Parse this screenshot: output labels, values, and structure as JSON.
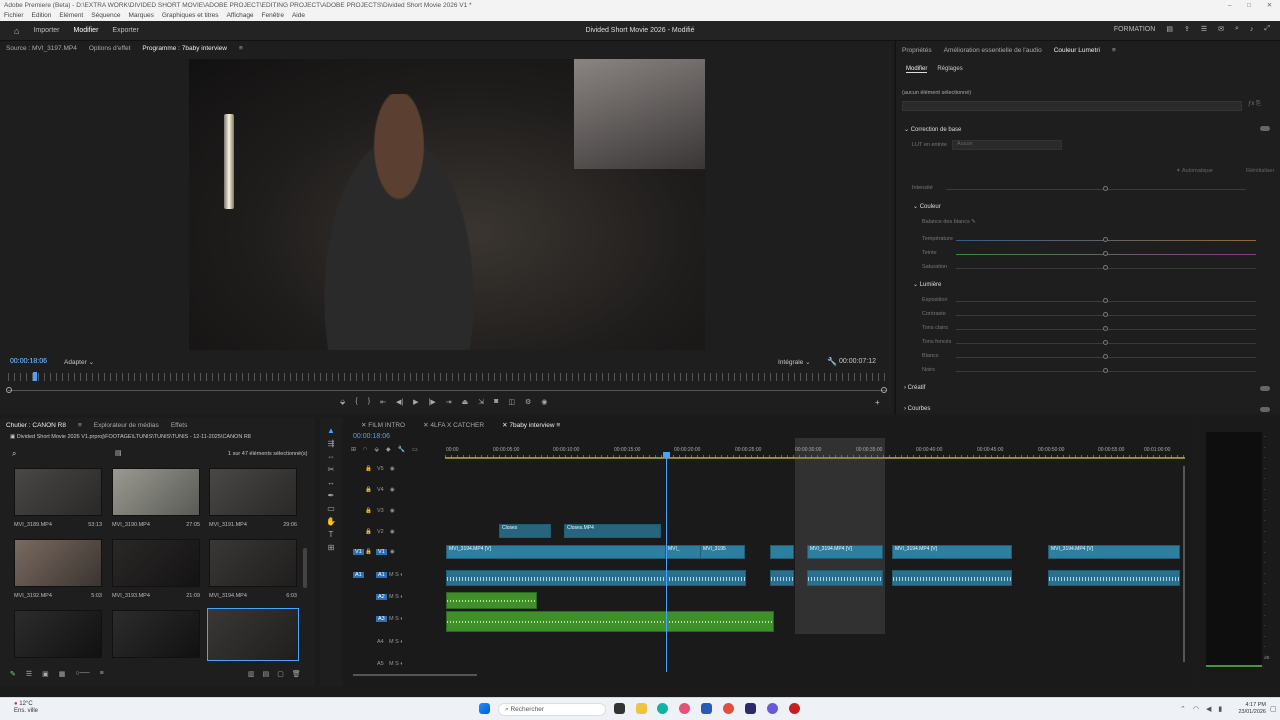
{
  "window": {
    "title": "Adobe Premiere (Beta) - D:\\EXTRA WORK\\DIVIDED SHORT MOVIE\\ADOBE PROJECT\\EDITING PROJECT\\ADOBE PROJECTS\\Divided Short Movie 2026 V1 *"
  },
  "menu": [
    "Fichier",
    "Edition",
    "Elément",
    "Séquence",
    "Marques",
    "Graphiques et titres",
    "Affichage",
    "Fenêtre",
    "Aide"
  ],
  "appbar": {
    "home_icon": "home-icon",
    "nav": [
      "Importer",
      "Modifier",
      "Exporter"
    ],
    "active_nav": "Modifier",
    "project_title": "Divided Short Movie 2026 - Modifié",
    "workspace": "FORMATION"
  },
  "source_panel": {
    "tabs": [
      "Source : MVI_3197.MP4",
      "Options d'effet",
      "Programme : 7baby interview"
    ],
    "timecode_left": "00:00:18:06",
    "fit": "Adapter",
    "quality": "Intégrale",
    "timecode_right": "00:00:07:12"
  },
  "lumetri": {
    "tabs": [
      "Propriétés",
      "Amélioration essentielle de l'audio",
      "Couleur Lumetri"
    ],
    "subtabs": [
      "Modifier",
      "Réglages"
    ],
    "selection": "(aucun élément sélectionné)",
    "basic_correction": "Correction de base",
    "lut_label": "LUT en entrée",
    "lut_value": "Aucun",
    "auto_btn": "Automatique",
    "reset_btn": "Réinitialiser",
    "intensity": "Intensité",
    "color_section": "Couleur",
    "white_balance": "Balance des blancs",
    "color_sliders": [
      "Température",
      "Teinte",
      "Saturation"
    ],
    "light_section": "Lumière",
    "light_sliders": [
      "Exposition",
      "Contraste",
      "Tons clairs",
      "Tons foncés",
      "Blancs",
      "Noirs"
    ],
    "creative": "Créatif",
    "curves": "Courbes"
  },
  "project_panel": {
    "tabs": [
      "Chutier : CANON R8",
      "Explorateur de médias",
      "Effets"
    ],
    "path": "Divided Short Movie 2026 V1.prproj\\FOOTAGE\\LTUNIS\\TUNIS\\TUNIS - 12-11-2025\\CANON R8",
    "count": "1 sur 47 éléments sélectionné(s)",
    "clips": [
      {
        "name": "MVI_3189.MP4",
        "duration": "53:13"
      },
      {
        "name": "MVI_3190.MP4",
        "duration": "27:05"
      },
      {
        "name": "MVI_3191.MP4",
        "duration": "29:06"
      },
      {
        "name": "MVI_3192.MP4",
        "duration": "5:03"
      },
      {
        "name": "MVI_3193.MP4",
        "duration": "21:09"
      },
      {
        "name": "MVI_3194.MP4",
        "duration": "6:03"
      },
      {
        "name": "",
        "duration": ""
      },
      {
        "name": "",
        "duration": ""
      },
      {
        "name": "",
        "duration": ""
      }
    ]
  },
  "timeline": {
    "tabs": [
      "FILM INTRO",
      "4LFA X CATCHER",
      "7baby interview"
    ],
    "timecode": "00:00:18:06",
    "ruler": [
      "00:00",
      "00:00:05:00",
      "00:00:10:00",
      "00:00:15:00",
      "00:00:20:00",
      "00:00:25:00",
      "00:00:30:00",
      "00:00:35:00",
      "00:00:40:00",
      "00:00:45:00",
      "00:00:50:00",
      "00:00:55:00",
      "00:01:00:00"
    ],
    "video_tracks": [
      "V5",
      "V4",
      "V3",
      "V2",
      "V1"
    ],
    "audio_tracks": [
      "A1",
      "A2",
      "A3",
      "A4",
      "A5"
    ],
    "clips_v2": [
      "Closes",
      "Closes.MP4"
    ],
    "clips_v1": [
      "MVI_3194.MP4 [V]",
      "MVI_",
      "MVI_3195",
      "MVI_3194.MP4 [V]",
      "MVI_3194.MP4 [V]",
      "MVI_3194.MP4 [V]"
    ]
  },
  "taskbar": {
    "weather_temp": "12°C",
    "weather_text": "Ens. ville",
    "search": "Rechercher",
    "time": "4:17 PM",
    "date": "23/01/2026"
  }
}
